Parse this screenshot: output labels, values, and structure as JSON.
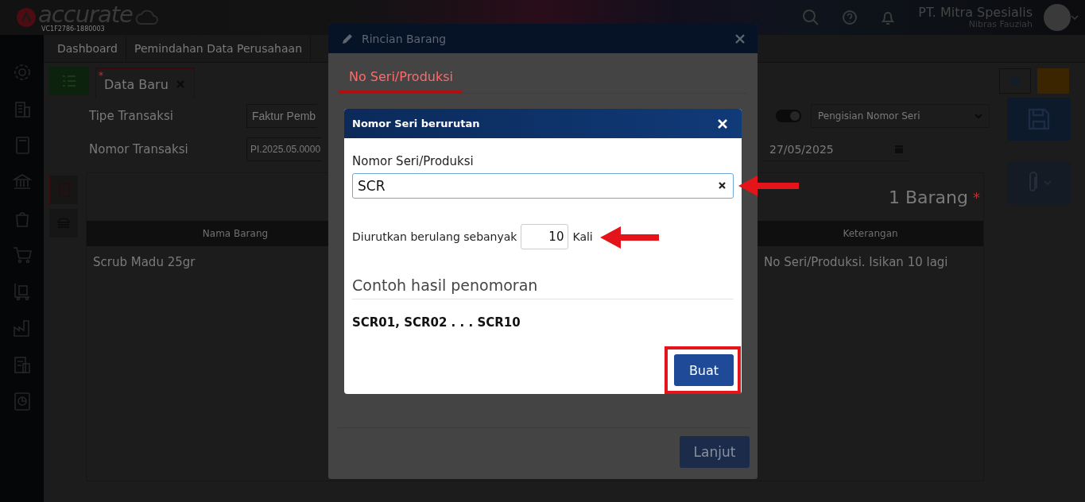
{
  "header": {
    "logo": "accurate",
    "logo_sub": "VC1F2786-1880003",
    "company": "PT. Mitra Spesialis",
    "user": "Nibras Fauziah"
  },
  "nav_tabs": [
    {
      "label": "Dashboard"
    },
    {
      "label": "Pemindahan Data Perusahaan"
    }
  ],
  "doc_tab": {
    "label": "Data Baru",
    "modified_mark": "*",
    "selected": true
  },
  "form": {
    "fields": [
      {
        "label": "Tipe Transaksi",
        "value": "Faktur Pemb"
      },
      {
        "label": "Nomor Transaksi",
        "value": "PI.2025.05.0000"
      }
    ],
    "serial_toggle": {
      "on": true
    },
    "serial_mode": "Pengisian Nomor Seri",
    "date": "27/05/2025"
  },
  "items": {
    "count": "1 Barang",
    "required_mark": "*",
    "columns": [
      "Nama Barang",
      "Keterangan"
    ],
    "rows": [
      [
        "Scrub Madu 25gr",
        "No Seri/Produksi. Isikan 10 lagi"
      ]
    ]
  },
  "detail_dialog": {
    "title": "Rincian Barang",
    "tabs": [
      {
        "label": "No Seri/Produksi",
        "selected": true
      }
    ],
    "next_button": "Lanjut"
  },
  "serial_dialog": {
    "title": "Nomor Seri berurutan",
    "field_label": "Nomor Seri/Produksi",
    "value": "SCR",
    "repeat_label": "Diurutkan berulang sebanyak",
    "repeat_value": "10",
    "repeat_unit": "Kali",
    "example_title": "Contoh hasil penomoran",
    "example": "SCR01, SCR02 . . . SCR10",
    "create_button": "Buat"
  }
}
